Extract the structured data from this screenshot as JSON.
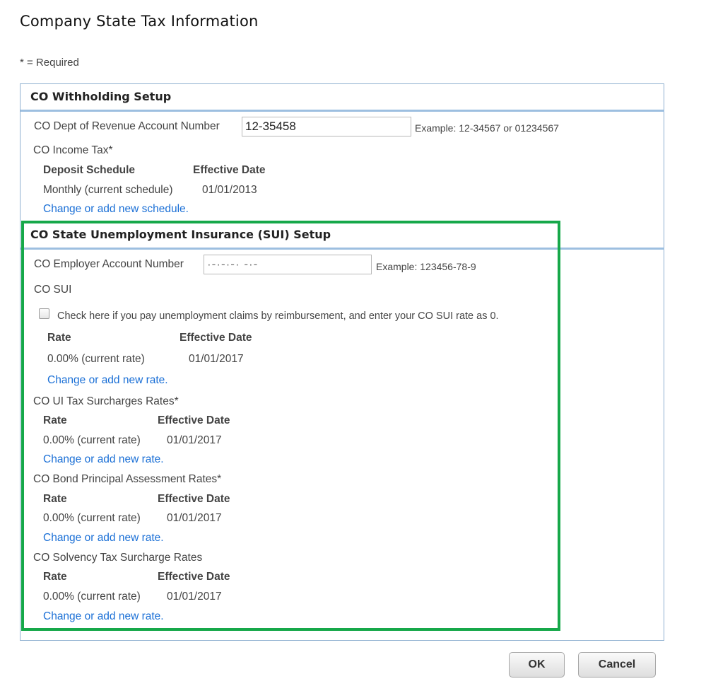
{
  "page": {
    "title": "Company State Tax Information",
    "required_note": "* = Required"
  },
  "withholding": {
    "section_title": "CO Withholding Setup",
    "account_label": "CO Dept of Revenue Account Number",
    "account_value": "12-35458",
    "account_example": "Example: 12-34567 or 01234567",
    "income_tax_label": "CO Income Tax*",
    "headers": {
      "col1": "Deposit Schedule",
      "col2": "Effective Date"
    },
    "row": {
      "schedule": "Monthly (current schedule)",
      "date": "01/01/2013"
    },
    "change_link": "Change or add new schedule."
  },
  "sui": {
    "section_title": "CO State Unemployment Insurance (SUI) Setup",
    "employer_label": "CO Employer Account Number",
    "employer_value": "·-·-·-· -·-",
    "employer_example": "Example: 123456-78-9",
    "sui_label": "CO SUI",
    "reimburse_checked": false,
    "reimburse_label": "Check here if you pay unemployment claims by reimbursement, and enter your CO SUI rate as 0.",
    "rate_headers": {
      "col1": "Rate",
      "col2": "Effective Date"
    },
    "rate_row": {
      "rate": "0.00% (current rate)",
      "date": "01/01/2017"
    },
    "change_link": "Change or add new rate."
  },
  "surcharges": [
    {
      "label": "CO UI Tax Surcharges Rates*",
      "col1": "Rate",
      "col2": "Effective Date",
      "rate": "0.00% (current rate)",
      "date": "01/01/2017",
      "link": "Change or add new rate."
    },
    {
      "label": "CO Bond Principal Assessment Rates*",
      "col1": "Rate",
      "col2": "Effective Date",
      "rate": "0.00% (current rate)",
      "date": "01/01/2017",
      "link": "Change or add new rate."
    },
    {
      "label": "CO Solvency Tax Surcharge Rates",
      "col1": "Rate",
      "col2": "Effective Date",
      "rate": "0.00% (current rate)",
      "date": "01/01/2017",
      "link": "Change or add new rate."
    }
  ],
  "buttons": {
    "ok": "OK",
    "cancel": "Cancel"
  },
  "colors": {
    "link": "#1a6fd6",
    "highlight": "#16a84a",
    "section_rule": "#9dbfe0"
  }
}
